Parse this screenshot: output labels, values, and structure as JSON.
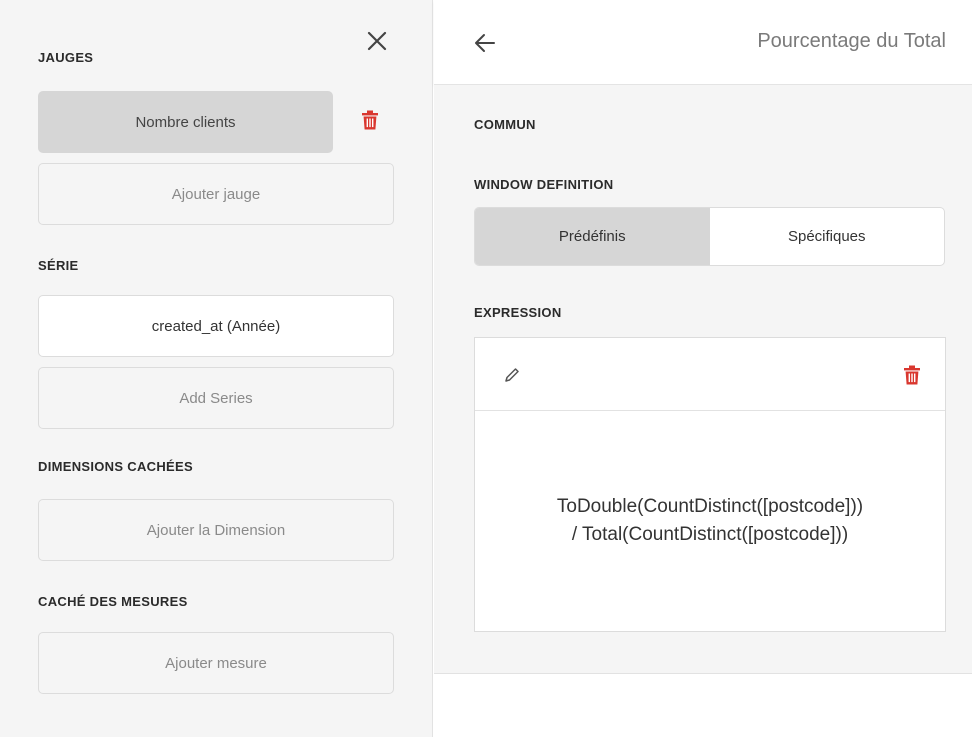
{
  "left": {
    "close_icon": "close-icon",
    "gauges": {
      "title": "JAUGES",
      "item": "Nombre clients",
      "add": "Ajouter jauge"
    },
    "series": {
      "title": "SÉRIE",
      "item": "created_at (Année)",
      "add": "Add Series"
    },
    "hidden_dimensions": {
      "title": "DIMENSIONS CACHÉES",
      "add": "Ajouter la Dimension"
    },
    "hidden_measures": {
      "title": "CACHÉ DES MESURES",
      "add": "Ajouter mesure"
    }
  },
  "right": {
    "header_title": "Pourcentage du Total",
    "common_title": "COMMUN",
    "window_definition": {
      "title": "WINDOW DEFINITION",
      "options": [
        "Prédéfinis",
        "Spécifiques"
      ],
      "selected": "Prédéfinis"
    },
    "expression": {
      "title": "EXPRESSION",
      "line1": "ToDouble(CountDistinct([postcode]))",
      "line2": "/ Total(CountDistinct([postcode]))"
    }
  },
  "colors": {
    "danger": "#d9372f",
    "panel_bg": "#f5f5f5",
    "selected_bg": "#d6d6d6"
  }
}
